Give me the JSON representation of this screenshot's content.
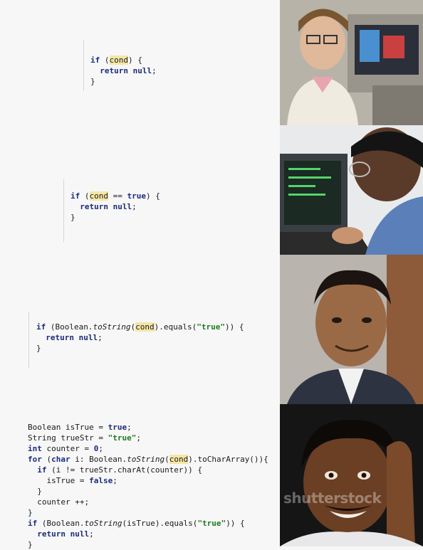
{
  "snippets": {
    "s1": {
      "if": "if",
      "open": " (",
      "cond": "cond",
      "close": ") {",
      "ret": "return",
      "null": "null",
      "semi": ";",
      "brace": "}"
    },
    "s2": {
      "if": "if",
      "open": " (",
      "cond": "cond",
      "eq": " == ",
      "true": "true",
      "close": ") {",
      "ret": "return",
      "null": "null",
      "semi": ";",
      "brace": "}"
    },
    "s3": {
      "if": "if",
      "p1": " (Boolean.",
      "toString": "toString",
      "paren": "(",
      "cond": "cond",
      "p2": ").equals(",
      "str": "\"true\"",
      "p3": ")) {",
      "ret": "return",
      "null": "null",
      "semi": ";",
      "brace": "}"
    },
    "s4": {
      "l1a": "Boolean isTrue = ",
      "l1b": "true",
      "l1c": ";",
      "l2a": "String trueStr = ",
      "l2b": "\"true\"",
      "l2c": ";",
      "l3a": "int",
      "l3b": " counter = ",
      "l3c": "0",
      "l3d": ";",
      "l4a": "for",
      "l4b": " (",
      "l4c": "char",
      "l4d": " i: Boolean.",
      "l4e": "toString",
      "l4f": "(",
      "l4g": "cond",
      "l4h": ").toCharArray()){",
      "l5a": "if",
      "l5b": " (i != trueStr.charAt(counter)) {",
      "l6a": "isTrue = ",
      "l6b": "false",
      "l6c": ";",
      "l7": "}",
      "l8": "counter ++;",
      "l9": "}",
      "l10a": "if",
      "l10b": " (Boolean.",
      "l10c": "toString",
      "l10d": "(isTrue).equals(",
      "l10e": "\"true\"",
      "l10f": ")) {",
      "l11a": "return",
      "l11b": "null",
      "l11c": ";",
      "l12": "}"
    }
  },
  "watermark": "shutterstock",
  "colors": {
    "keyword": "#1b2b7a",
    "string": "#1f7a1f",
    "highlight": "#f4e6a6"
  }
}
